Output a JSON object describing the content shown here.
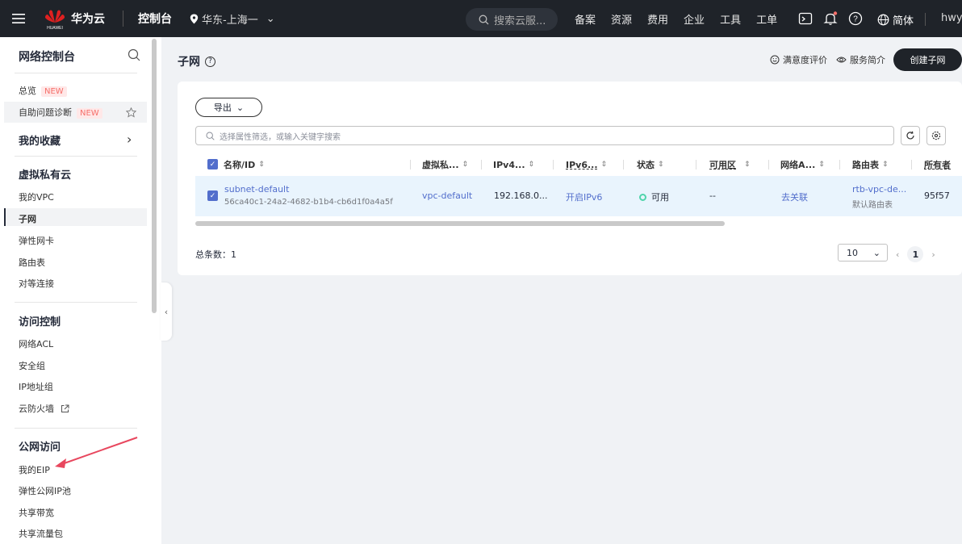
{
  "topbar": {
    "brand": "华为云",
    "brand_sub": "HUAWEI",
    "console": "控制台",
    "region": "华东-上海一",
    "search_placeholder": "搜索云服...",
    "nav": [
      "备案",
      "资源",
      "费用",
      "企业",
      "工具",
      "工单"
    ],
    "lang": "简体",
    "user": "hwy"
  },
  "sidebar": {
    "title": "网络控制台",
    "overview": "总览",
    "self_diag": "自助问题诊断",
    "new_badge": "NEW",
    "favorites": "我的收藏",
    "vpc_group": "虚拟私有云",
    "my_vpc": "我的VPC",
    "subnet": "子网",
    "eni": "弹性网卡",
    "route_table": "路由表",
    "peering": "对等连接",
    "access_group": "访问控制",
    "acl": "网络ACL",
    "security_group": "安全组",
    "ip_group": "IP地址组",
    "firewall": "云防火墙",
    "public_group": "公网访问",
    "my_eip": "我的EIP",
    "eip_pool": "弹性公网IP池",
    "bandwidth": "共享带宽",
    "data_package": "共享流量包"
  },
  "main": {
    "title": "子网",
    "satisfaction": "满意度评价",
    "service_intro": "服务简介",
    "create_button": "创建子网",
    "export_button": "导出",
    "filter_placeholder": "选择属性筛选，或输入关键字搜索",
    "columns": {
      "name": "名称/ID",
      "vpc": "虚拟私...",
      "ipv4": "IPv4...",
      "ipv6": "IPv6...",
      "status": "状态",
      "az": "可用区",
      "nacl": "网络A...",
      "route": "路由表",
      "owner": "所有者"
    },
    "row": {
      "name": "subnet-default",
      "id": "56ca40c1-24a2-4682-b1b4-cb6d1f0a4a5f",
      "vpc": "vpc-default",
      "ipv4": "192.168.0...",
      "ipv6": "开启IPv6",
      "status": "可用",
      "az": "--",
      "nacl": "去关联",
      "route": "rtb-vpc-de...",
      "route_sub": "默认路由表",
      "owner": "95f57"
    },
    "total": "总条数：1",
    "page_size": "10",
    "current_page": "1"
  },
  "colors": {
    "topbar": "#1f2329",
    "link": "#526ecc",
    "status_ok": "#50d4ab",
    "new_badge": "#f66f6a"
  }
}
